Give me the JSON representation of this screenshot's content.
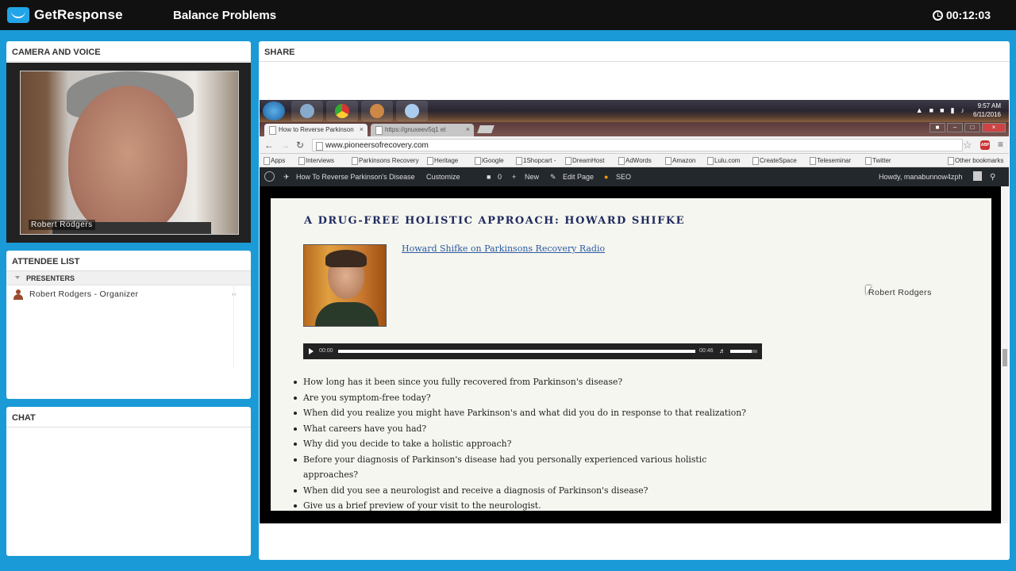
{
  "app": {
    "brand": "GetResponse",
    "title": "Balance Problems",
    "timer": "00:12:03"
  },
  "camera": {
    "header": "CAMERA AND VOICE",
    "name_label": "Robert Rodgers"
  },
  "attendees": {
    "header": "ATTENDEE LIST",
    "group": "PRESENTERS",
    "items": [
      {
        "name": "Robert Rodgers - Organizer"
      }
    ]
  },
  "chat": {
    "header": "CHAT"
  },
  "share": {
    "header": "SHARE",
    "cursor_label": "Robert Rodgers"
  },
  "desktop": {
    "time": "9:57 AM",
    "date": "6/11/2016"
  },
  "browser": {
    "tabs": [
      {
        "label": "How to Reverse Parkinson"
      },
      {
        "label": "https://gnuxeev5q1 et"
      }
    ],
    "url": "www.pioneersofrecovery.com",
    "bookmarks": [
      "Apps",
      "Interviews",
      "Parkinsons Recovery",
      "Heritage",
      "iGoogle",
      "1Shopcart -",
      "DreamHost",
      "AdWords",
      "Amazon",
      "Lulu.com",
      "CreateSpace",
      "Teleseminar",
      "Twitter",
      "Other bookmarks"
    ],
    "wp_bar": {
      "site": "How To Reverse Parkinson's Disease",
      "customize": "Customize",
      "comments": "0",
      "new": "New",
      "edit": "Edit Page",
      "seo": "SEO",
      "howdy": "Howdy, manabunnow4zph"
    }
  },
  "page": {
    "title": "A DRUG-FREE HOLISTIC APPROACH: HOWARD SHIFKE",
    "link": "Howard Shifke  on Parkinsons Recovery Radio",
    "player": {
      "current": "00:00",
      "duration": "00:46",
      "progress": 0
    },
    "questions": [
      "How long has it been since you fully recovered from Parkinson's disease?",
      "Are you symptom-free today?",
      "When did you realize you might have Parkinson's and what did you do in response to that realization?",
      "What careers have you had?",
      "Why did you decide to take a holistic approach?",
      "Before your diagnosis of Parkinson's disease had you personally experienced various holistic approaches?",
      "When did you see a neurologist and receive a diagnosis of Parkinson's disease?",
      "Give us a brief preview of your visit to the neurologist."
    ]
  }
}
